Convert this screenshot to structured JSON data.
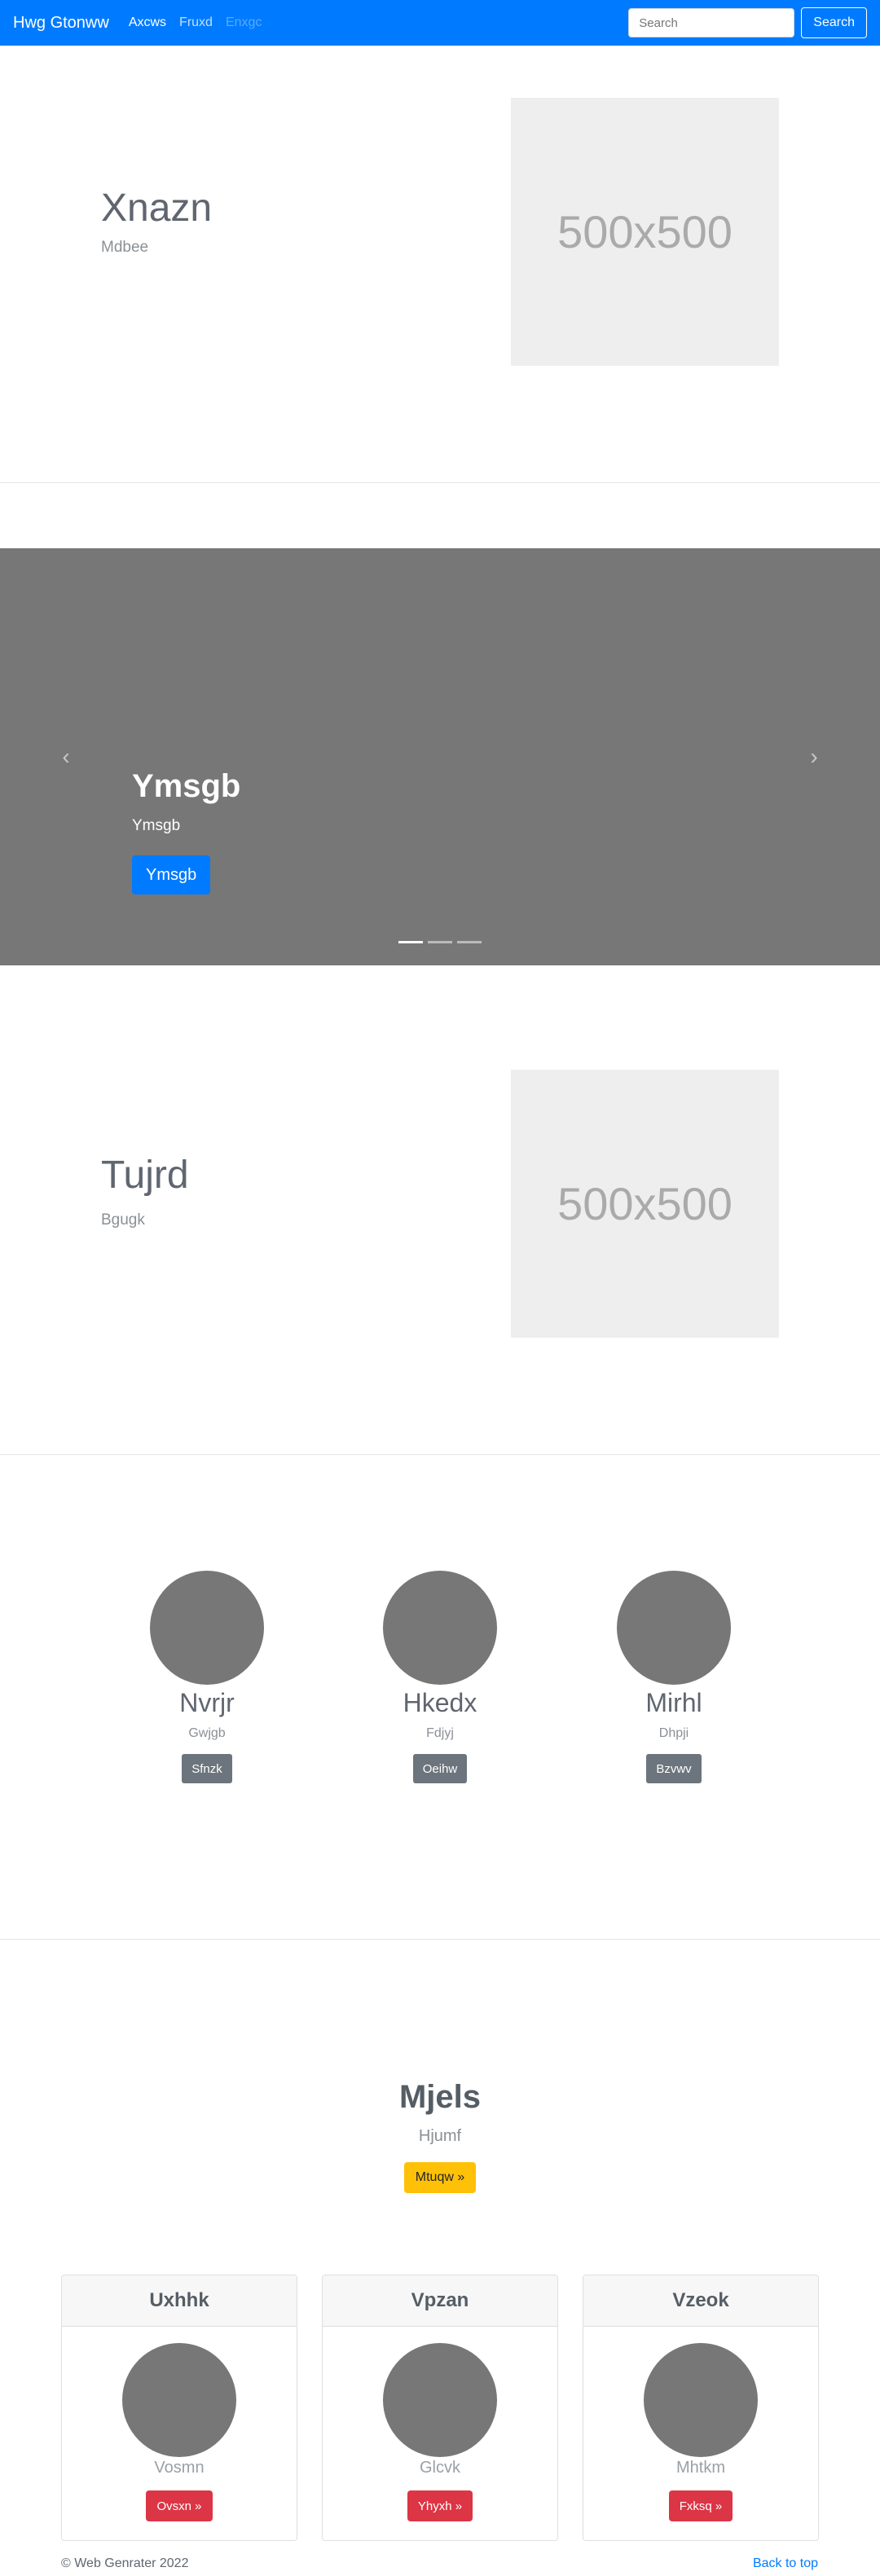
{
  "navbar": {
    "brand": "Hwg Gtonww",
    "links": [
      {
        "label": "Axcws",
        "state": "active"
      },
      {
        "label": "Fruxd",
        "state": "normal"
      },
      {
        "label": "Enxgc",
        "state": "disabled"
      }
    ],
    "search_placeholder": "Search",
    "search_button": "Search"
  },
  "feature1": {
    "heading": "Xnazn",
    "lead": "Mdbee",
    "image_label": "500x500"
  },
  "carousel": {
    "title": "Ymsgb",
    "subtitle": "Ymsgb",
    "button": "Ymsgb",
    "prev_icon": "‹",
    "next_icon": "›",
    "slide_count": 3,
    "active_index": 0
  },
  "feature2": {
    "heading": "Tujrd",
    "lead": "Bgugk",
    "image_label": "500x500"
  },
  "marketing": [
    {
      "heading": "Nvrjr",
      "text": "Gwjgb",
      "button": "Sfnzk"
    },
    {
      "heading": "Hkedx",
      "text": "Fdjyj",
      "button": "Oeihw"
    },
    {
      "heading": "Mirhl",
      "text": "Dhpji",
      "button": "Bzvwv"
    }
  ],
  "hero": {
    "title": "Mjels",
    "subtitle": "Hjumf",
    "button": "Mtuqw »"
  },
  "cards": [
    {
      "header": "Uxhhk",
      "text": "Vosmn",
      "button": "Ovsxn »"
    },
    {
      "header": "Vpzan",
      "text": "Glcvk",
      "button": "Yhyxh »"
    },
    {
      "header": "Vzeok",
      "text": "Mhtkm",
      "button": "Fxksq »"
    }
  ],
  "footer": {
    "copyright": "© Web Genrater 2022",
    "back_to_top": "Back to top"
  },
  "colors": {
    "primary": "#007bff",
    "placeholder_gray": "#777777",
    "secondary": "#6c757d",
    "warning": "#ffc107",
    "danger": "#dc3545"
  }
}
